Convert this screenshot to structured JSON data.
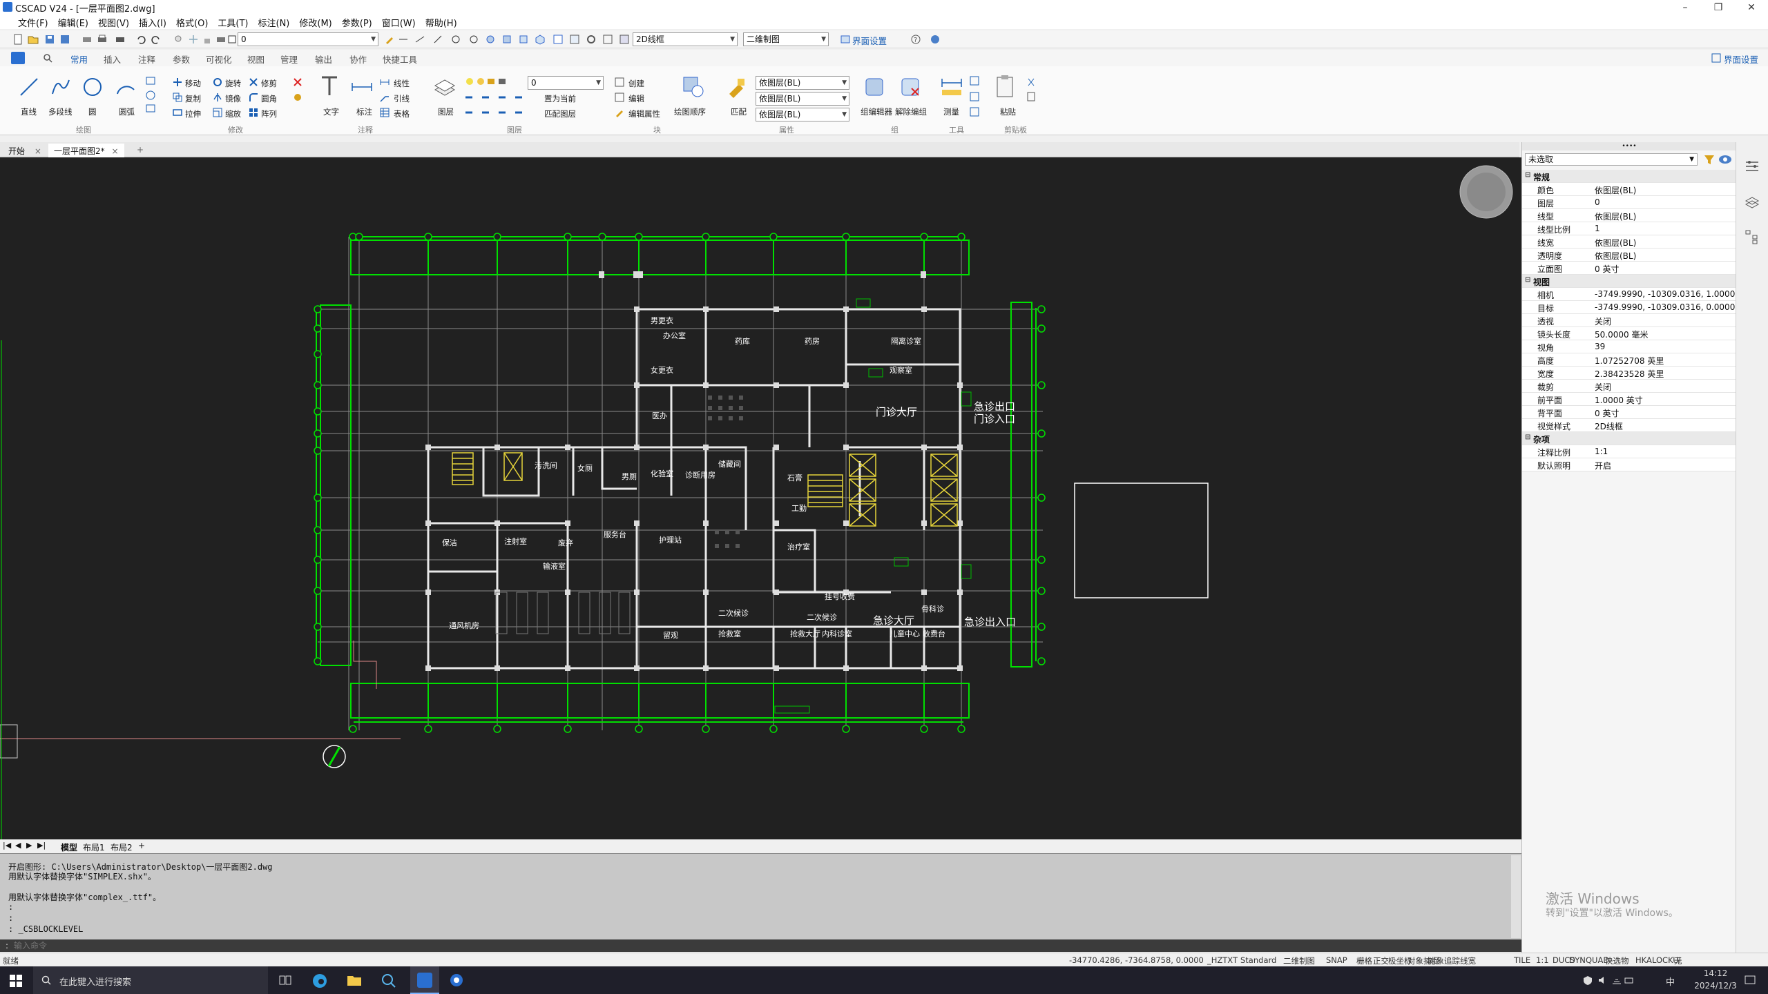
{
  "window": {
    "title": "CSCAD V24 - [一层平面图2.dwg]",
    "minimize": "–",
    "restore": "❐",
    "close": "✕"
  },
  "menu": [
    "文件(F)",
    "编辑(E)",
    "视图(V)",
    "插入(I)",
    "格式(O)",
    "工具(T)",
    "标注(N)",
    "修改(M)",
    "参数(P)",
    "窗口(W)",
    "帮助(H)"
  ],
  "qat": {
    "layer_value": "0",
    "visual_style": "2D线框",
    "workspace": "二维制图",
    "ui_settings": "界面设置"
  },
  "ribbon_tabs": [
    "常用",
    "插入",
    "注释",
    "参数",
    "可视化",
    "视图",
    "管理",
    "输出",
    "协作",
    "快捷工具"
  ],
  "ribbon_right": "界面设置",
  "ribbon": {
    "draw": {
      "line": "直线",
      "polyline": "多段线",
      "circle": "圆",
      "arc": "圆弧",
      "group": "绘图"
    },
    "modify": {
      "move": "移动",
      "rotate": "旋转",
      "trim": "修剪",
      "copy": "复制",
      "mirror": "镜像",
      "fillet": "圆角",
      "stretch": "拉伸",
      "scale": "缩放",
      "array": "阵列",
      "group": "修改"
    },
    "annotation": {
      "text": "文字",
      "dimension": "标注",
      "linear": "线性",
      "leader": "引线",
      "table": "表格",
      "group": "注释"
    },
    "layers": {
      "layer": "图层",
      "layer_value": "0",
      "set_current": "置为当前",
      "match_layer": "匹配图层",
      "group": "图层"
    },
    "block": {
      "create": "创建",
      "edit": "编辑",
      "edit_attr": "编辑属性",
      "insert": "块",
      "group": "块"
    },
    "properties": {
      "match": "匹配",
      "color": "依图层(BL)",
      "linetype": "依图层(BL)",
      "lineweight": "依图层(BL)",
      "group": "属性",
      "draw_order": "绘图顺序"
    },
    "groups": {
      "group_editor": "组编辑器",
      "ungroup": "解除编组",
      "group": "组"
    },
    "tools": {
      "measure": "测量",
      "group": "工具"
    },
    "clipboard": {
      "paste": "粘贴",
      "group": "剪贴板"
    }
  },
  "doc_tabs": [
    "开始",
    "一层平面图2*"
  ],
  "layout_tabs": [
    "模型",
    "布局1",
    "布局2"
  ],
  "command_lines": [
    "开启图形: C:\\Users\\Administrator\\Desktop\\一层平面图2.dwg",
    "用默认字体替换字体\"SIMPLEX.shx\"。",
    "",
    "用默认字体替换字体\"complex_.ttf\"。",
    ":",
    ":",
    ": _CSBLOCKLEVEL"
  ],
  "command_prompt": "输入命令",
  "status": {
    "left": "就绪",
    "coords": "-34770.4286, -7364.8758, 0.0000",
    "items": [
      "_HZTXT",
      "Standard",
      "二维制图",
      "SNAP",
      "栅格",
      "正交",
      "极坐标",
      "对象捕捉",
      "对象追踪",
      "线宽",
      "TILE",
      "1:1",
      "DUCS",
      "DYN",
      "QUAD",
      "快选物",
      "HKA",
      "LOCKUI",
      "无"
    ]
  },
  "drawing": {
    "labels": [
      "男更衣",
      "办公室",
      "女更衣",
      "药库",
      "药房",
      "隔离诊室",
      "观察室",
      "医办",
      "门诊大厅",
      "急诊出口",
      "门诊入口",
      "污洗间",
      "化验室",
      "女厕",
      "男厕",
      "诊断用房",
      "储藏间",
      "石膏",
      "工勤",
      "保洁",
      "注射室",
      "废弃",
      "服务台",
      "护理站",
      "治疗室",
      "输液室",
      "急诊出入口",
      "挂号收费",
      "急诊大厅",
      "通风机房",
      "留观",
      "抢救室",
      "抢救大厅",
      "内科诊室",
      "二次候诊",
      "儿童中心",
      "收费台",
      "二次候诊",
      "骨科诊"
    ]
  },
  "props": {
    "selector": "未选取",
    "sections": [
      {
        "title": "常规",
        "rows": [
          [
            "颜色",
            "依图层(BL)"
          ],
          [
            "图层",
            "0"
          ],
          [
            "线型",
            "依图层(BL)"
          ],
          [
            "线型比例",
            "1"
          ],
          [
            "线宽",
            "依图层(BL)"
          ],
          [
            "透明度",
            "依图层(BL)"
          ],
          [
            "立面图",
            "0 英寸"
          ]
        ]
      },
      {
        "title": "视图",
        "rows": [
          [
            "相机",
            "-3749.9990, -10309.0316, 1.0000"
          ],
          [
            "目标",
            "-3749.9990, -10309.0316, 0.0000"
          ],
          [
            "透视",
            "关闭"
          ],
          [
            "镜头长度",
            "50.0000 毫米"
          ],
          [
            "视角",
            "39"
          ],
          [
            "高度",
            "1.07252708 英里"
          ],
          [
            "宽度",
            "2.38423528 英里"
          ],
          [
            "裁剪",
            "关闭"
          ],
          [
            "前平面",
            "1.0000 英寸"
          ],
          [
            "背平面",
            "0 英寸"
          ],
          [
            "视觉样式",
            "2D线框"
          ]
        ]
      },
      {
        "title": "杂项",
        "rows": [
          [
            "注释比例",
            "1:1"
          ],
          [
            "默认照明",
            "开启"
          ]
        ]
      }
    ]
  },
  "watermark": {
    "line1": "激活 Windows",
    "line2": "转到\"设置\"以激活 Windows。"
  },
  "taskbar": {
    "search": "在此键入进行搜索",
    "time": "14:12",
    "date": "2024/12/3",
    "ime": "中"
  }
}
